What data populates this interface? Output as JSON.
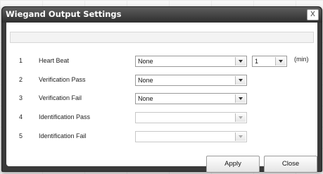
{
  "dialog": {
    "title": "Wiegand Output Settings",
    "close_label": "X"
  },
  "rows": [
    {
      "num": "1",
      "label": "Heart Beat",
      "value": "None",
      "interval": "1",
      "unit": "(min)"
    },
    {
      "num": "2",
      "label": "Verification Pass",
      "value": "None"
    },
    {
      "num": "3",
      "label": "Verification Fail",
      "value": "None"
    },
    {
      "num": "4",
      "label": "Identification Pass",
      "value": "",
      "disabled": true
    },
    {
      "num": "5",
      "label": "Identification Fail",
      "value": "",
      "disabled": true
    }
  ],
  "buttons": {
    "apply": "Apply",
    "close": "Close"
  }
}
